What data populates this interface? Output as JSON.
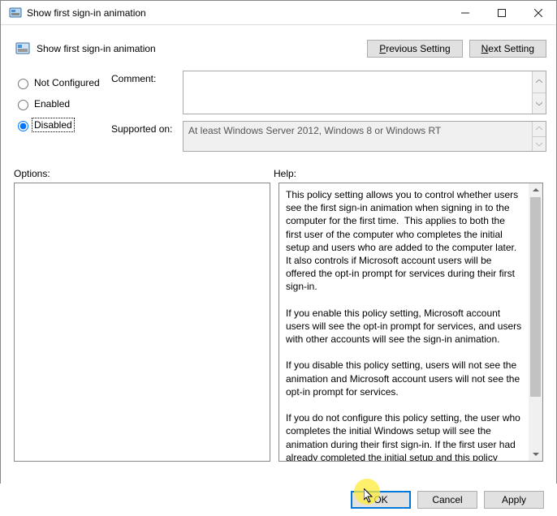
{
  "window": {
    "title": "Show first sign-in animation"
  },
  "header": {
    "title": "Show first sign-in animation",
    "prev_prefix": "P",
    "prev_label": "revious Setting",
    "next_prefix": "N",
    "next_label": "ext Setting"
  },
  "state": {
    "options": [
      "Not Configured",
      "Enabled",
      "Disabled"
    ],
    "selected": "Disabled"
  },
  "fields": {
    "comment_label": "Comment:",
    "comment_value": "",
    "supported_label": "Supported on:",
    "supported_value": "At least Windows Server 2012, Windows 8 or Windows RT"
  },
  "mid": {
    "options_label": "Options:",
    "help_label": "Help:"
  },
  "help": {
    "text": "This policy setting allows you to control whether users see the first sign-in animation when signing in to the computer for the first time.  This applies to both the first user of the computer who completes the initial setup and users who are added to the computer later.  It also controls if Microsoft account users will be offered the opt-in prompt for services during their first sign-in.\n\nIf you enable this policy setting, Microsoft account users will see the opt-in prompt for services, and users with other accounts will see the sign-in animation.\n\nIf you disable this policy setting, users will not see the animation and Microsoft account users will not see the opt-in prompt for services.\n\nIf you do not configure this policy setting, the user who completes the initial Windows setup will see the animation during their first sign-in. If the first user had already completed the initial setup and this policy setting is not configured, users new to this computer will not see the animation."
  },
  "footer": {
    "ok": "OK",
    "cancel": "Cancel",
    "apply": "Apply"
  }
}
